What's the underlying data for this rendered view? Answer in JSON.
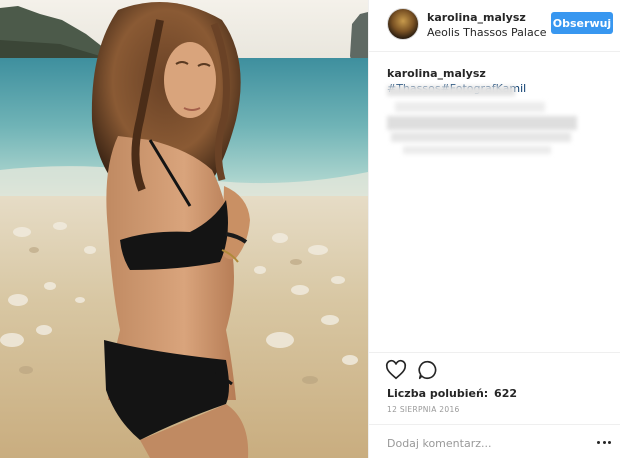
{
  "post": {
    "author": {
      "username": "karolina_malysz",
      "location": "Aeolis Thassos Palace",
      "follow_label": "Obserwuj"
    },
    "caption": {
      "username": "karolina_malysz",
      "hashtag_1": "#Thassos",
      "hashtag_2": "#FotografKamil"
    },
    "likes": {
      "label": "Liczba polubień:",
      "count": "622"
    },
    "date": "12 SIERPNIA 2016",
    "comment": {
      "placeholder": "Dodaj komentarz..."
    },
    "icons": {
      "like": "heart-icon",
      "comment": "comment-bubble-icon",
      "more": "more-options-icon"
    }
  },
  "colors": {
    "follow_button": "#3897f0",
    "hashtag": "#003569",
    "muted_text": "#999999",
    "border": "#efefef"
  }
}
